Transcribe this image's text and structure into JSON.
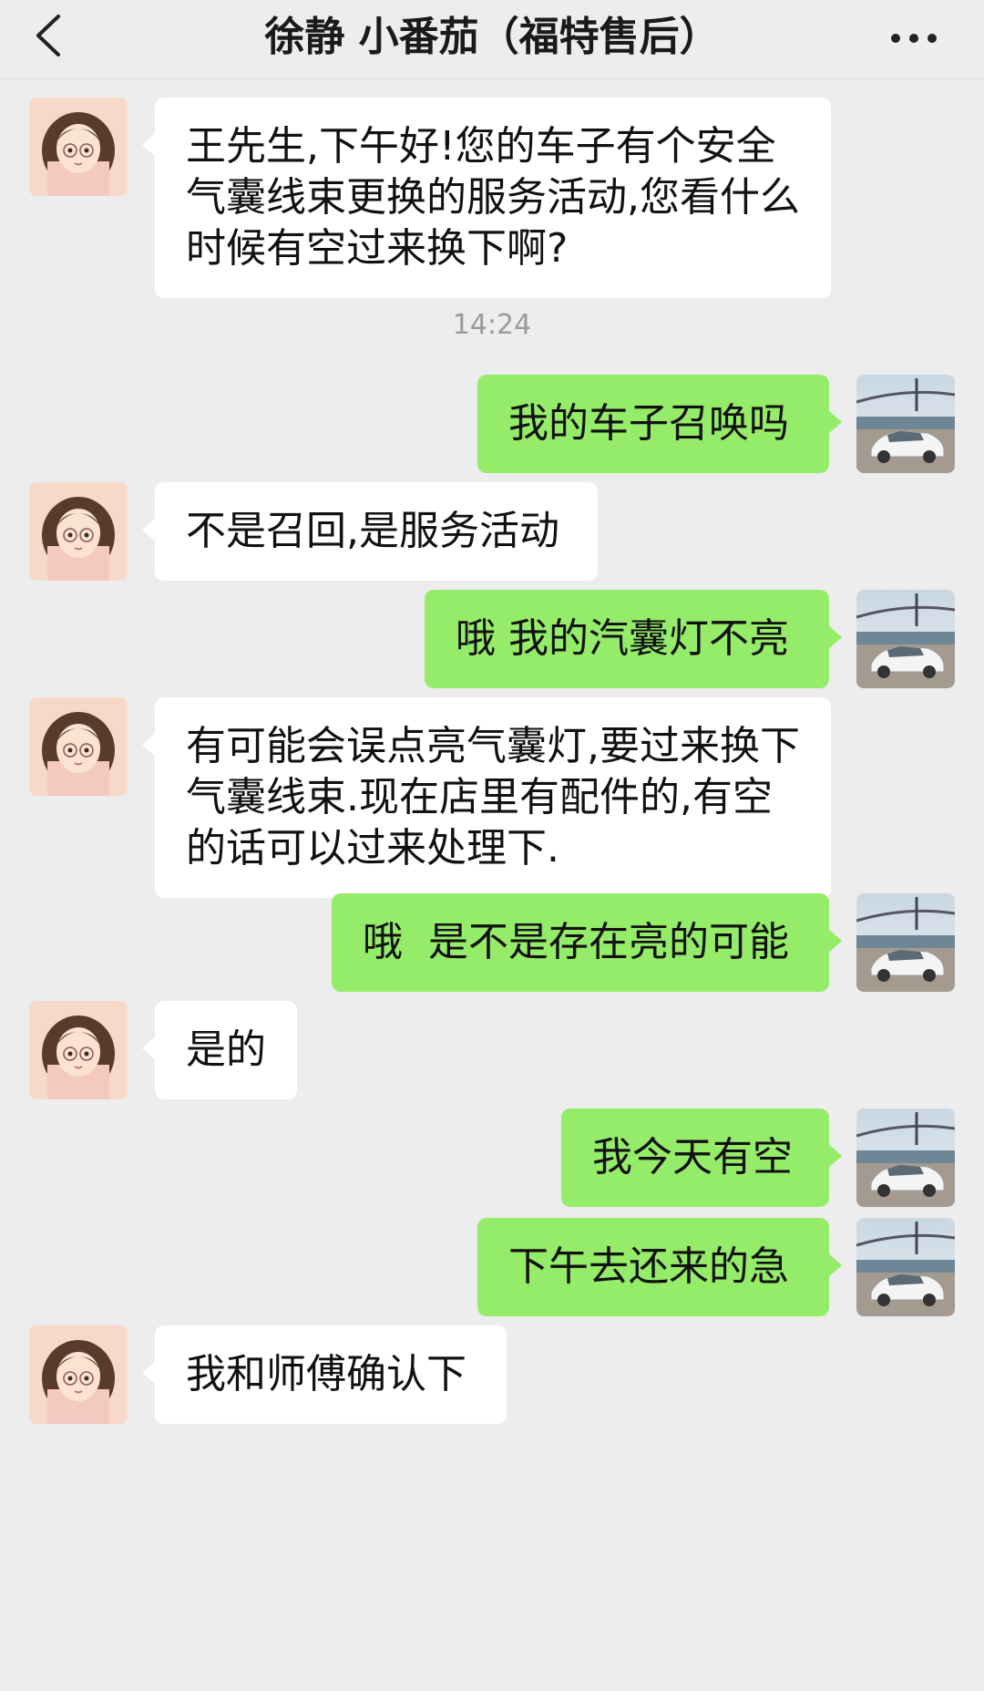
{
  "header": {
    "back_icon": "chevron-left-icon",
    "title": "徐静 小番茄（福特售后）",
    "more_icon": "more-dots-icon"
  },
  "messages": [
    {
      "from": "them",
      "text": "王先生,下午好!您的车子有个安全气囊线束更换的服务活动,您看什么时候有空过来换下啊?"
    },
    {
      "timestamp": "14:24"
    },
    {
      "from": "me",
      "text": "我的车子召唤吗"
    },
    {
      "from": "them",
      "text": "不是召回,是服务活动"
    },
    {
      "from": "me",
      "text": "哦 我的汽囊灯不亮"
    },
    {
      "from": "them",
      "text": "有可能会误点亮气囊灯,要过来换下气囊线束.现在店里有配件的,有空的话可以过来处理下."
    },
    {
      "from": "me",
      "text": "哦  是不是存在亮的可能"
    },
    {
      "from": "them",
      "text": "是的"
    },
    {
      "from": "me",
      "text": "我今天有空"
    },
    {
      "from": "me",
      "text": "下午去还来的急"
    },
    {
      "from": "them",
      "text": "我和师傅确认下"
    }
  ],
  "colors": {
    "background": "#ededed",
    "incoming_bubble": "#ffffff",
    "outgoing_bubble": "#95ec69",
    "timestamp": "#9b9b9b"
  }
}
